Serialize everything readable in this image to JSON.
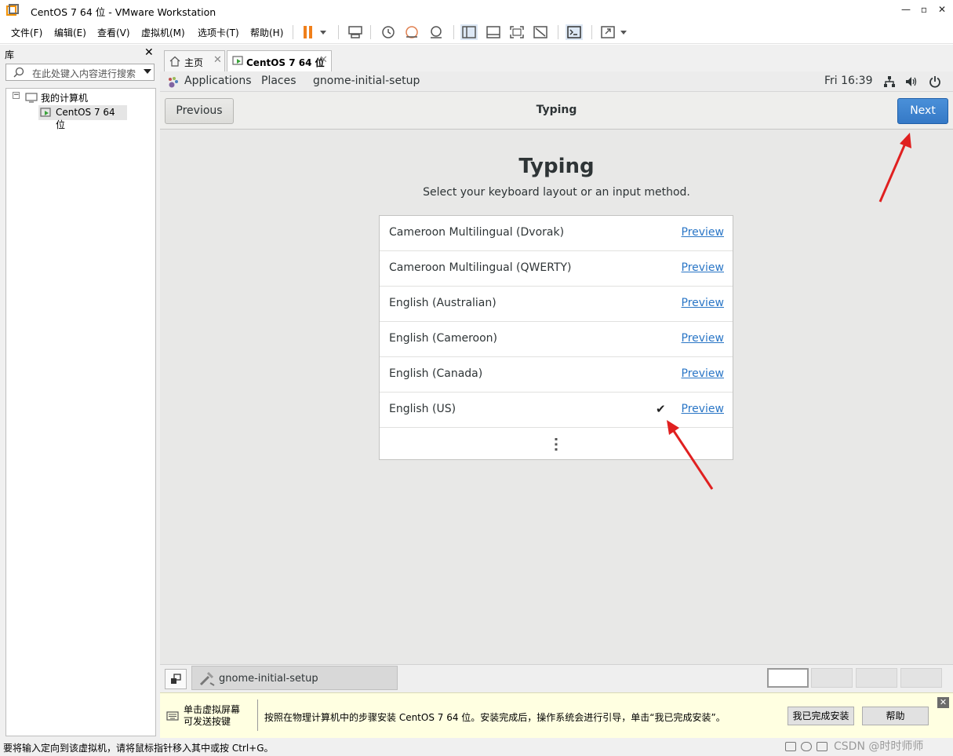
{
  "window": {
    "title": "CentOS 7 64 位 - VMware Workstation"
  },
  "menu": [
    "文件(F)",
    "编辑(E)",
    "查看(V)",
    "虚拟机(M)",
    "选项卡(T)",
    "帮助(H)"
  ],
  "library": {
    "heading": "库",
    "search_placeholder": "在此处键入内容进行搜索",
    "tree": {
      "root": "我的计算机",
      "child": "CentOS 7 64 位"
    }
  },
  "tabs": [
    {
      "label": "主页"
    },
    {
      "label": "CentOS 7 64 位"
    }
  ],
  "gnome_topbar": {
    "applications": "Applications",
    "places": "Places",
    "app_name": "gnome-initial-setup",
    "clock": "Fri 16:39"
  },
  "setup": {
    "previous_label": "Previous",
    "header_title": "Typing",
    "next_label": "Next",
    "page_title": "Typing",
    "subtitle": "Select your keyboard layout or an input method.",
    "preview_label": "Preview",
    "layouts": [
      {
        "name": "Cameroon Multilingual (Dvorak)",
        "selected": false
      },
      {
        "name": "Cameroon Multilingual (QWERTY)",
        "selected": false
      },
      {
        "name": "English (Australian)",
        "selected": false
      },
      {
        "name": "English (Cameroon)",
        "selected": false
      },
      {
        "name": "English (Canada)",
        "selected": false
      },
      {
        "name": "English (US)",
        "selected": true
      }
    ],
    "check_glyph": "✔"
  },
  "guest_taskbar": {
    "task_label": "gnome-initial-setup"
  },
  "hint": {
    "left_line1": "单击虚拟屏幕",
    "left_line2": "可发送按键",
    "message": "按照在物理计算机中的步骤安装 CentOS 7 64 位。安装完成后，操作系统会进行引导，单击“我已完成安装”。",
    "done_button": "我已完成安装",
    "help_button": "帮助"
  },
  "status": {
    "message": "要将输入定向到该虚拟机，请将鼠标指针移入其中或按 Ctrl+G。",
    "watermark": "CSDN @时时师师"
  },
  "colors": {
    "accent_next": "#3579c6",
    "link": "#2a76c6",
    "annotation_arrow": "#e02020"
  }
}
